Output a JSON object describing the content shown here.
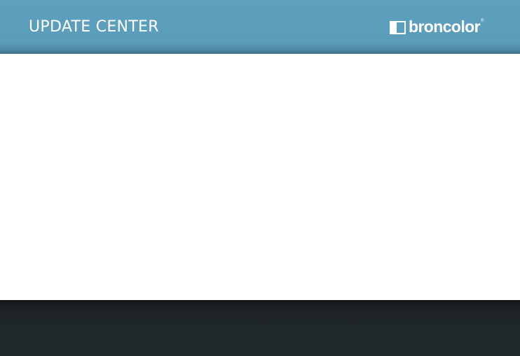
{
  "header": {
    "title": "UPDATE CENTER",
    "logo": {
      "text": "broncolor",
      "registered_mark": "®"
    }
  },
  "colors": {
    "header_bg": "#5ea1bf",
    "content_bg": "#ffffff",
    "footer_bg": "#20272a",
    "header_text": "#ffffff"
  }
}
